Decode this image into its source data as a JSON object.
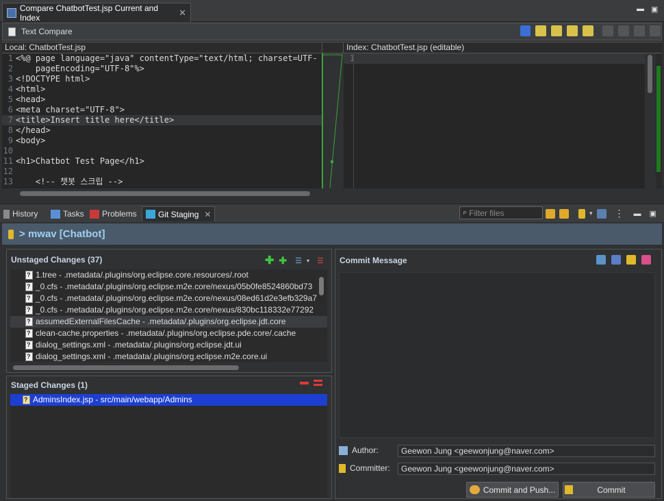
{
  "editor_tab": {
    "title": "Compare ChatbotTest.jsp Current and Index"
  },
  "compare": {
    "header": "Text Compare",
    "left_title": "Local: ChatbotTest.jsp",
    "right_title": "Index: ChatbotTest.jsp (editable)",
    "left_lines": [
      {
        "n": "1",
        "text": "<%@ page language=\"java\" contentType=\"text/html; charset=UTF-"
      },
      {
        "n": "2",
        "text": "    pageEncoding=\"UTF-8\"%>"
      },
      {
        "n": "3",
        "text": "<!DOCTYPE html>"
      },
      {
        "n": "4",
        "text": "<html>"
      },
      {
        "n": "5",
        "text": "<head>"
      },
      {
        "n": "6",
        "text": "<meta charset=\"UTF-8\">"
      },
      {
        "n": "7",
        "text": "<title>Insert title here</title>"
      },
      {
        "n": "8",
        "text": "</head>"
      },
      {
        "n": "9",
        "text": "<body>"
      },
      {
        "n": "10",
        "text": ""
      },
      {
        "n": "11",
        "text": "<h1>Chatbot Test Page</h1>"
      },
      {
        "n": "12",
        "text": ""
      },
      {
        "n": "13",
        "text": "    <!-- 챗봇 스크립 -->"
      }
    ],
    "right_line_number": "1"
  },
  "views": {
    "tabs": [
      "History",
      "Tasks",
      "Problems",
      "Git Staging"
    ],
    "filter_placeholder": "Filter files"
  },
  "repo": {
    "prefix": ">",
    "name": "mwav [Chatbot]"
  },
  "unstaged": {
    "title": "Unstaged Changes (37)",
    "files": [
      "1.tree - .metadata/.plugins/org.eclipse.core.resources/.root",
      "_0.cfs - .metadata/.plugins/org.eclipse.m2e.core/nexus/05b0fe8524860bd73",
      "_0.cfs - .metadata/.plugins/org.eclipse.m2e.core/nexus/08ed61d2e3efb329a7",
      "_0.cfs - .metadata/.plugins/org.eclipse.m2e.core/nexus/830bc118332e77292",
      "assumedExternalFilesCache - .metadata/.plugins/org.eclipse.jdt.core",
      "clean-cache.properties - .metadata/.plugins/org.eclipse.pde.core/.cache",
      "dialog_settings.xml - .metadata/.plugins/org.eclipse.jdt.ui",
      "dialog_settings.xml - .metadata/.plugins/org.eclipse.m2e.core.ui"
    ]
  },
  "staged": {
    "title": "Staged Changes (1)",
    "files": [
      "AdminsIndex.jsp - src/main/webapp/Admins"
    ]
  },
  "commit": {
    "title": "Commit Message",
    "message": "",
    "author_label": "Author:",
    "author_value": "Geewon Jung <geewonjung@naver.com>",
    "committer_label": "Committer:",
    "committer_value": "Geewon Jung <geewonjung@naver.com>",
    "commit_push_label": "Commit and Push...",
    "commit_label": "Commit"
  },
  "colors": {
    "accent_green": "#3ba33b",
    "selection_blue": "#1d3fd1",
    "repo_title": "#9fd0f5"
  }
}
